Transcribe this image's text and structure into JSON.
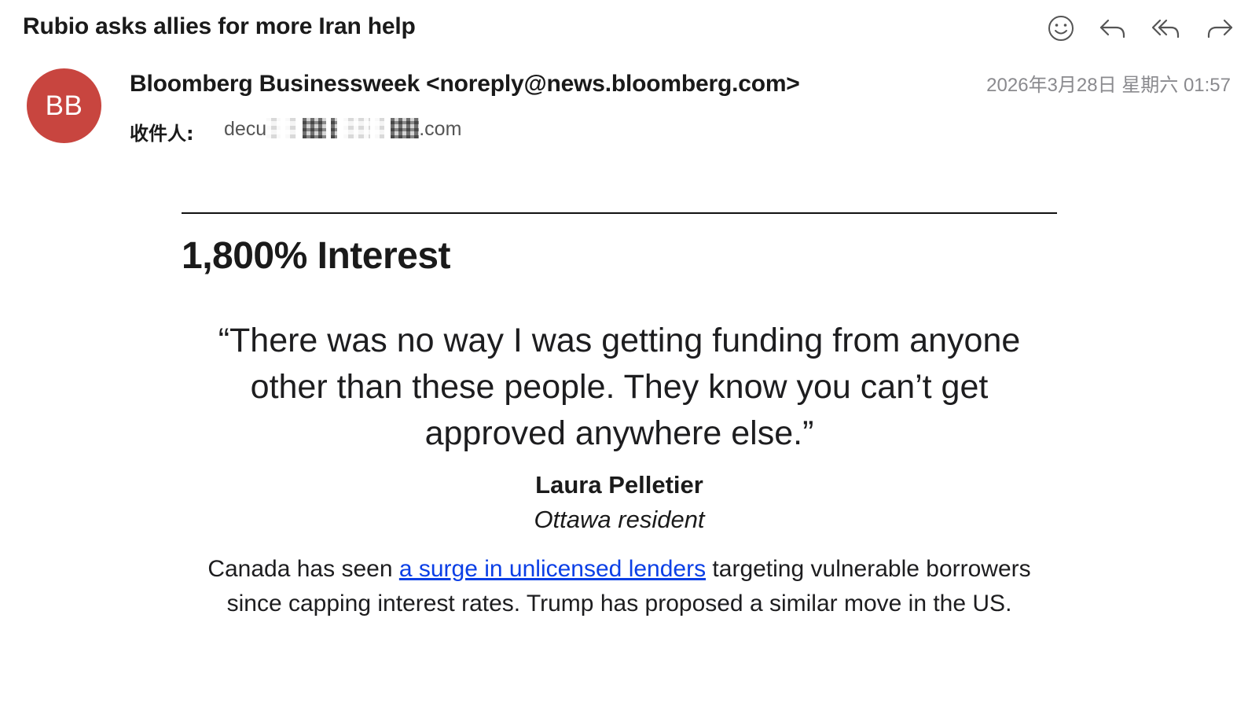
{
  "colors": {
    "avatar_bg": "#c8453f",
    "link": "#0b3fe6",
    "date_text": "#8a8a8e"
  },
  "email": {
    "subject": "Rubio asks allies for more Iran help",
    "toolbar": [
      {
        "name": "emoji-reaction",
        "icon": "smiley-icon"
      },
      {
        "name": "reply",
        "icon": "reply-arrow-icon"
      },
      {
        "name": "reply-all",
        "icon": "reply-all-arrow-icon"
      },
      {
        "name": "forward",
        "icon": "forward-arrow-icon"
      }
    ],
    "avatar_initials": "BB",
    "sender": "Bloomberg Businessweek <noreply@news.bloomberg.com>",
    "date": "2026年3月28日 星期六 01:57",
    "to_label": "收件人:",
    "to_address_prefix": "decu",
    "to_address_suffix": ".com"
  },
  "content": {
    "section_title": "1,800% Interest",
    "quote": "“There was no way I was getting funding from anyone other than these people. They know you can’t get approved anywhere else.”",
    "attribution_name": "Laura Pelletier",
    "attribution_role": "Ottawa resident",
    "paragraph_before_link": "Canada has seen ",
    "paragraph_link": "a surge in unlicensed lenders",
    "paragraph_after_link": " targeting vulnerable borrowers since capping interest rates. Trump has proposed a similar move in the US."
  }
}
